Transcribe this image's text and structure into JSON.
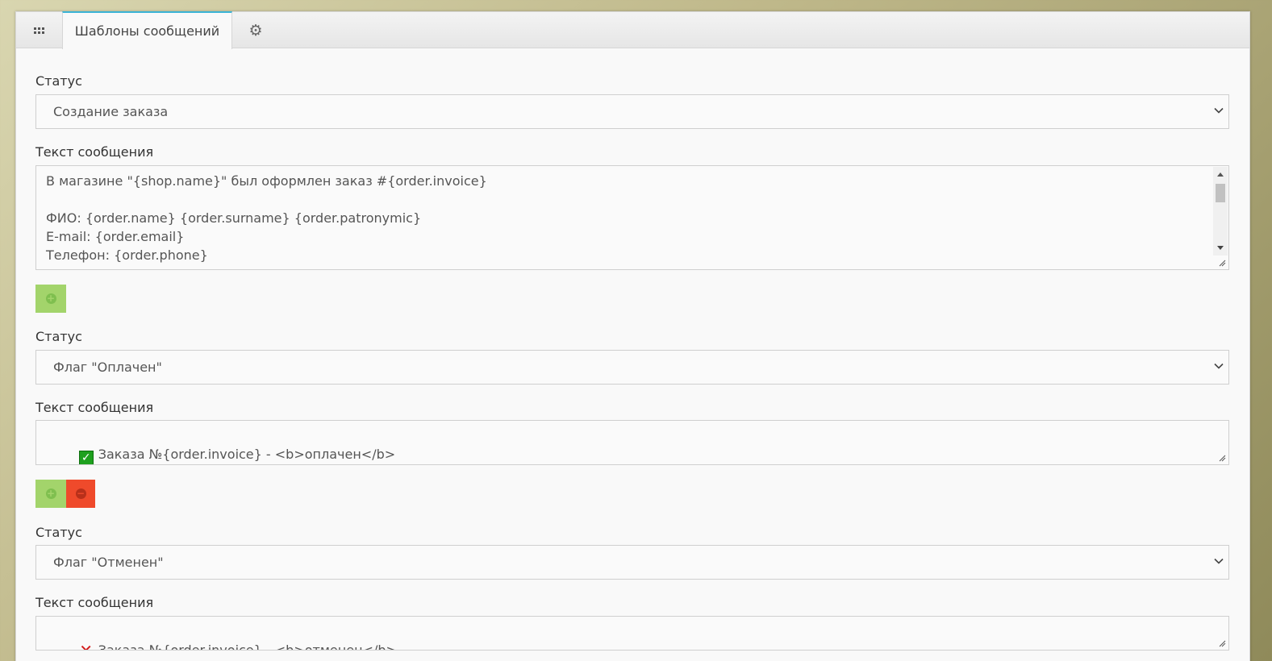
{
  "tabs": {
    "grid_icon": "grid-icon",
    "active_label": "Шаблоны сообщений",
    "gear_icon": "gear-icon"
  },
  "blocks": [
    {
      "status_label": "Статус",
      "status_value": "Создание заказа",
      "text_label": "Текст сообщения",
      "text_lines": [
        "В магазине \"{shop.name}\" был оформлен заказ #{order.invoice}",
        "",
        "ФИО: {order.name} {order.surname} {order.patronymic}",
        "E-mail: {order.email}",
        "Телефон: {order.phone}"
      ]
    },
    {
      "status_label": "Статус",
      "status_value": "Флаг \"Оплачен\"",
      "text_label": "Текст сообщения",
      "text_emoji": "check-mark-emoji",
      "text_value": "Заказа №{order.invoice} - <b>оплачен</b>"
    },
    {
      "status_label": "Статус",
      "status_value": "Флаг \"Отменен\"",
      "text_label": "Текст сообщения",
      "text_emoji": "cross-mark-emoji",
      "text_value": "Заказа №{order.invoice} - <b>отменен</b>"
    }
  ],
  "colors": {
    "accent_tab": "#3bb4d6",
    "add_button": "#a3d46b",
    "remove_button": "#ef4a2b"
  }
}
